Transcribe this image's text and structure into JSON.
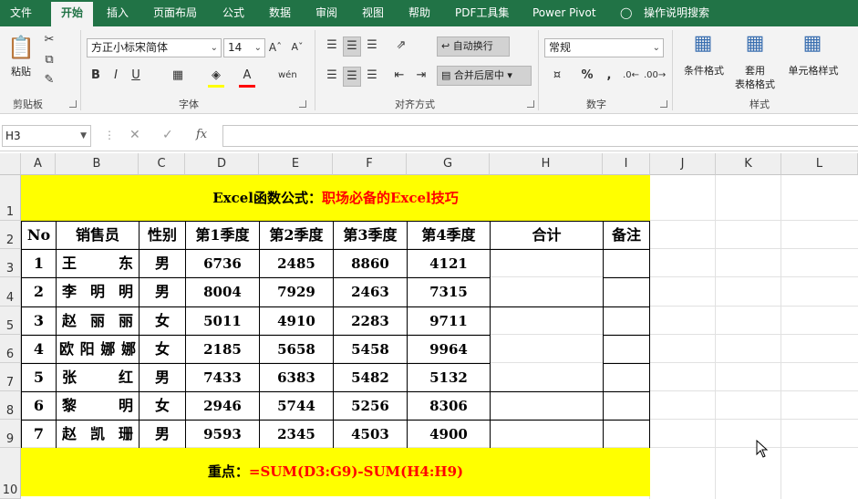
{
  "ribbon_tabs": [
    "文件",
    "开始",
    "插入",
    "页面布局",
    "公式",
    "数据",
    "审阅",
    "视图",
    "帮助",
    "PDF工具集",
    "Power Pivot",
    "操作说明搜索"
  ],
  "active_tab": "开始",
  "clipboard": {
    "paste": "粘贴",
    "group": "剪贴板"
  },
  "font": {
    "name": "方正小标宋简体",
    "size": "14",
    "group": "字体"
  },
  "alignment": {
    "wrap": "自动换行",
    "merge": "合并后居中",
    "group": "对齐方式"
  },
  "number": {
    "format": "常规",
    "group": "数字"
  },
  "styles": {
    "conditional": "条件格式",
    "table_top": "套用",
    "table_bottom": "表格格式",
    "cell_styles": "单元格样式",
    "group": "样式"
  },
  "formula_bar": {
    "name_box": "H3",
    "cancel": "✕",
    "enter": "✓",
    "fx": "fx",
    "value": ""
  },
  "columns": [
    "A",
    "B",
    "C",
    "D",
    "E",
    "F",
    "G",
    "H",
    "I",
    "J",
    "K",
    "L"
  ],
  "rows": [
    "1",
    "2",
    "3",
    "4",
    "5",
    "6",
    "7",
    "8",
    "9",
    "10"
  ],
  "sheet": {
    "title_black": "Excel函数公式：",
    "title_red": "职场必备的Excel技巧",
    "headers": [
      "No",
      "销售员",
      "性别",
      "第1季度",
      "第2季度",
      "第3季度",
      "第4季度",
      "合计",
      "备注"
    ],
    "data": [
      {
        "no": "1",
        "name": "王东",
        "sex": "男",
        "q1": "6736",
        "q2": "2485",
        "q3": "8860",
        "q4": "4121"
      },
      {
        "no": "2",
        "name": "李明明",
        "sex": "男",
        "q1": "8004",
        "q2": "7929",
        "q3": "2463",
        "q4": "7315"
      },
      {
        "no": "3",
        "name": "赵丽丽",
        "sex": "女",
        "q1": "5011",
        "q2": "4910",
        "q3": "2283",
        "q4": "9711"
      },
      {
        "no": "4",
        "name": "欧阳娜娜",
        "sex": "女",
        "q1": "2185",
        "q2": "5658",
        "q3": "5458",
        "q4": "9964"
      },
      {
        "no": "5",
        "name": "张红",
        "sex": "男",
        "q1": "7433",
        "q2": "6383",
        "q3": "5482",
        "q4": "5132"
      },
      {
        "no": "6",
        "name": "黎明",
        "sex": "女",
        "q1": "2946",
        "q2": "5744",
        "q3": "5256",
        "q4": "8306"
      },
      {
        "no": "7",
        "name": "赵凯珊",
        "sex": "男",
        "q1": "9593",
        "q2": "2345",
        "q3": "4503",
        "q4": "4900"
      }
    ],
    "footer_black": "重点：",
    "footer_red": "=SUM(D3:G9)-SUM(H4:H9)"
  },
  "colors": {
    "excel_green": "#217346",
    "highlight_yellow": "#ffff00",
    "accent_red": "#ff0000"
  }
}
